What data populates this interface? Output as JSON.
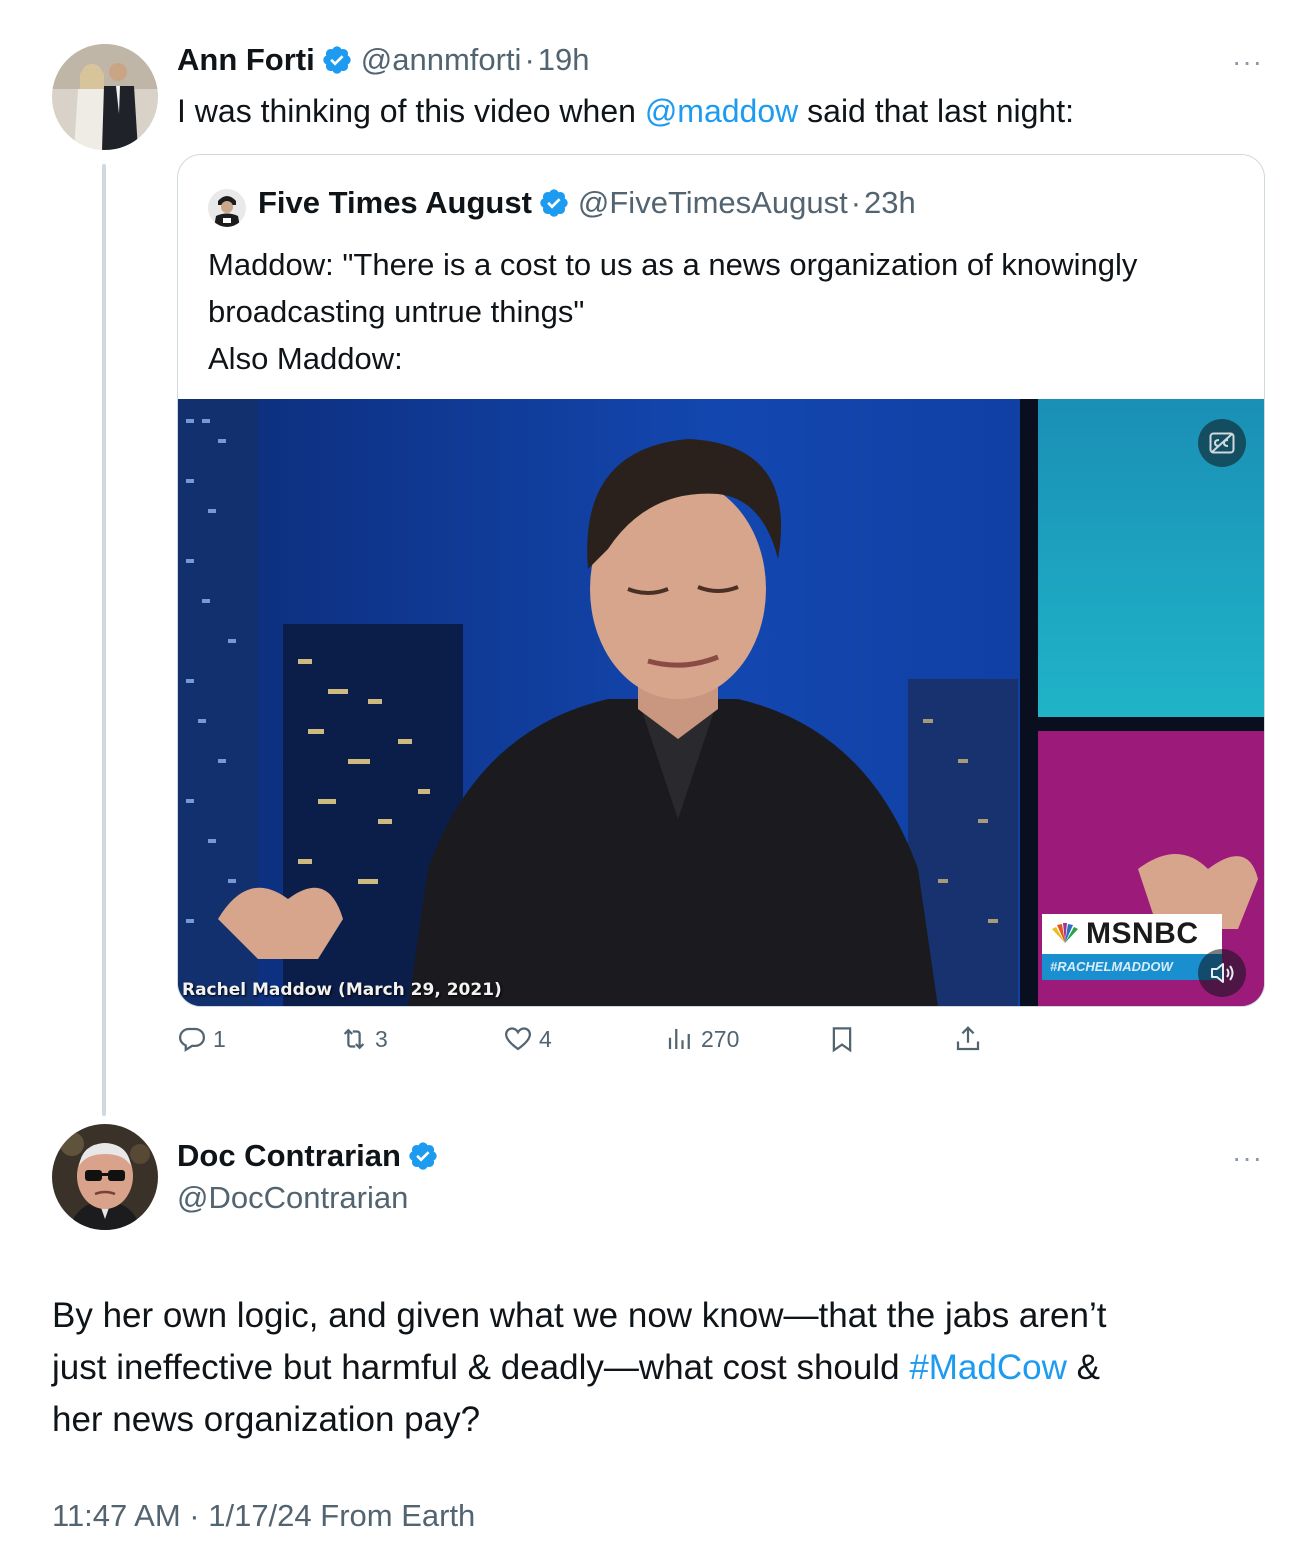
{
  "tweet1": {
    "name": "Ann Forti",
    "handle": "@annmforti",
    "separator": "·",
    "time": "19h",
    "text_before": "I was thinking of this video when ",
    "mention": "@maddow",
    "text_after": " said that last night:"
  },
  "quote": {
    "name": "Five Times August",
    "handle": "@FiveTimesAugust",
    "separator": "·",
    "time": "23h",
    "line1": "Maddow: \"There is a cost to us as a news organization of knowingly",
    "line2": "broadcasting untrue things\"",
    "line3": "Also Maddow:",
    "video": {
      "caption": "Rachel Maddow (March 29, 2021)",
      "network_logo": "MSNBC",
      "network_sub": "#RACHELMADDOW"
    }
  },
  "actions": {
    "replies": "1",
    "reposts": "3",
    "likes": "4",
    "views": "270"
  },
  "tweet2": {
    "name": "Doc Contrarian",
    "handle": "@DocContrarian",
    "line1": "By her own logic, and given what we now know—that the jabs aren’t",
    "line2_before": "just ineffective but harmful & deadly—what cost should ",
    "hashtag": "#MadCow",
    "line2_after": " &",
    "line3": "her news organization pay?",
    "meta": "11:47 AM · 1/17/24 From Earth"
  },
  "more_menu_label": "···",
  "colors": {
    "link": "#1d9bf0",
    "secondary_text": "#536471",
    "border": "#cfd9de",
    "verified": "#1d9bf0"
  }
}
